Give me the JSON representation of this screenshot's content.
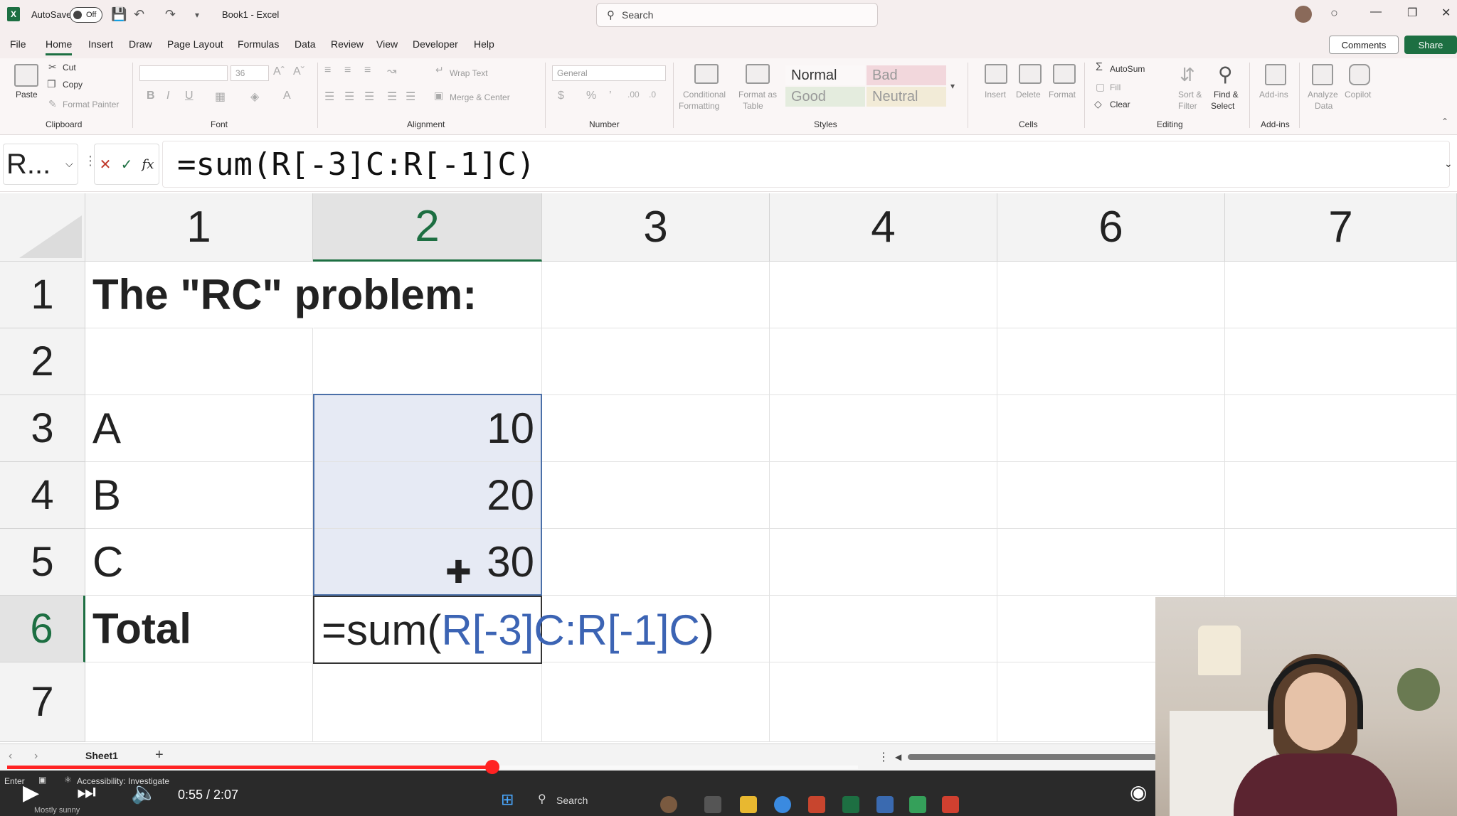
{
  "titlebar": {
    "autosave_label": "AutoSave",
    "autosave_state": "Off",
    "doc_title": "Book1  -  Excel",
    "search_placeholder": "Search"
  },
  "menu": {
    "tabs": [
      "File",
      "Home",
      "Insert",
      "Draw",
      "Page Layout",
      "Formulas",
      "Data",
      "Review",
      "View",
      "Developer",
      "Help"
    ],
    "active": "Home",
    "comments_label": "Comments",
    "share_label": "Share"
  },
  "ribbon": {
    "clipboard": {
      "label": "Clipboard",
      "paste": "Paste",
      "cut": "Cut",
      "copy": "Copy",
      "format_painter": "Format Painter"
    },
    "font": {
      "label": "Font",
      "size": "36"
    },
    "alignment": {
      "label": "Alignment",
      "wrap_text": "Wrap Text",
      "merge_center": "Merge & Center"
    },
    "number": {
      "label": "Number",
      "format": "General"
    },
    "styles": {
      "label": "Styles",
      "conditional_formatting_1": "Conditional",
      "conditional_formatting_2": "Formatting",
      "format_table_1": "Format as",
      "format_table_2": "Table",
      "normal": "Normal",
      "bad": "Bad",
      "good": "Good",
      "neutral": "Neutral"
    },
    "cells": {
      "label": "Cells",
      "insert": "Insert",
      "delete": "Delete",
      "format": "Format"
    },
    "editing": {
      "label": "Editing",
      "autosum": "AutoSum",
      "fill": "Fill",
      "clear": "Clear",
      "sort_filter_1": "Sort &",
      "sort_filter_2": "Filter",
      "find_select_1": "Find &",
      "find_select_2": "Select"
    },
    "addins": {
      "label": "Add-ins",
      "addins": "Add-ins",
      "analyze_1": "Analyze",
      "analyze_2": "Data",
      "copilot": "Copilot"
    }
  },
  "formula_bar": {
    "name_box": "R...",
    "formula": "=sum(R[-3]C:R[-1]C)"
  },
  "grid": {
    "columns": [
      "1",
      "2",
      "3",
      "4",
      "6",
      "7"
    ],
    "selected_column": "2",
    "rows": [
      "1",
      "2",
      "3",
      "4",
      "5",
      "6",
      "7"
    ],
    "selected_row": "6",
    "cells": {
      "r1c1": "The \"RC\" problem:",
      "r3c1": "A",
      "r3c2": "10",
      "r4c1": "B",
      "r4c2": "20",
      "r5c1": "C",
      "r5c2": "30",
      "r6c1": "Total"
    },
    "active_cell": {
      "prefix": "=sum(",
      "ref": "R[-3]C:R[-1]C",
      "suffix": ")"
    }
  },
  "sheets": {
    "tabs": [
      "Sheet1"
    ]
  },
  "status": {
    "mode": "Enter",
    "accessibility": "Accessibility: Investigate",
    "weather": "Mostly sunny",
    "taskbar_search": "Search"
  },
  "video": {
    "time": "0:55 / 2:07",
    "progress": 0.57
  }
}
